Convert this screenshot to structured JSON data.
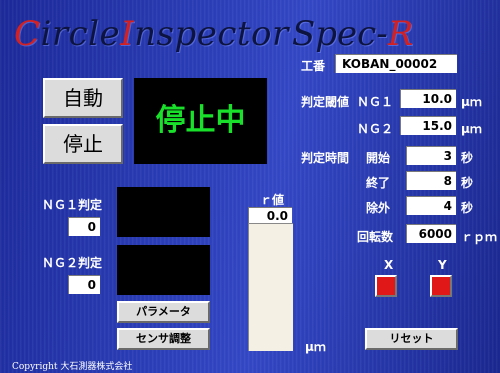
{
  "header": {
    "title_c": "C",
    "title_ircle": "ircle",
    "title_i": "I",
    "title_nspector": "nspector",
    "subtitle_spec": "Spec-",
    "subtitle_r": "R"
  },
  "koban": {
    "label": "工番",
    "value": "KOBAN_00002"
  },
  "controls": {
    "auto_label": "自動",
    "stop_label": "停止"
  },
  "status": {
    "text": "停止中",
    "color": "#19e02a"
  },
  "judge_threshold": {
    "label": "判定閾値",
    "ng1": {
      "label": "ＮＧ１",
      "value": "10.0",
      "unit": "μｍ"
    },
    "ng2": {
      "label": "ＮＧ２",
      "value": "15.0",
      "unit": "μｍ"
    }
  },
  "judge_time": {
    "label": "判定時間",
    "start": {
      "label": "開始",
      "value": "3",
      "unit": "秒"
    },
    "end": {
      "label": "終了",
      "value": "8",
      "unit": "秒"
    },
    "exclude": {
      "label": "除外",
      "value": "4",
      "unit": "秒"
    }
  },
  "rotation": {
    "label": "回転数",
    "value": "6000",
    "unit": "ｒｐｍ"
  },
  "ng1_judge": {
    "label": "ＮＧ１判定",
    "count": "0"
  },
  "ng2_judge": {
    "label": "ＮＧ２判定",
    "count": "0"
  },
  "r_value": {
    "label": "ｒ値",
    "value": "0.0",
    "unit": "μｍ"
  },
  "buttons": {
    "parameter": "パラメータ",
    "sensor_adjust": "センサ調整",
    "reset": "リセット"
  },
  "indicators": {
    "x_label": "X",
    "y_label": "Y",
    "lamp_color": "#e01818"
  },
  "footer": {
    "copyright": "Copyright 大石測器株式会社"
  }
}
